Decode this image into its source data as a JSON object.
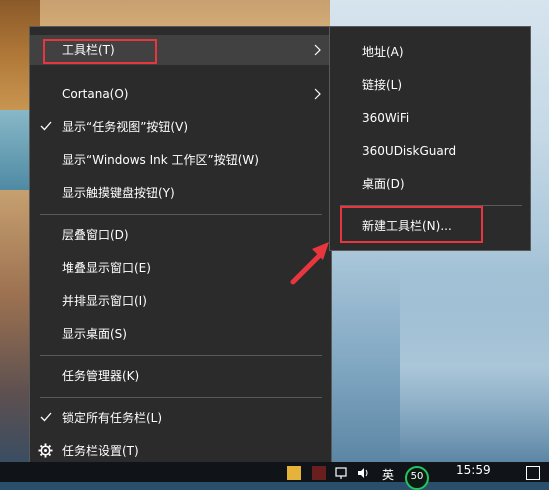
{
  "main_menu": {
    "items": [
      {
        "label": "工具栏(T)",
        "has_submenu": true
      },
      {
        "label": "Cortana(O)",
        "has_submenu": true
      },
      {
        "label": "显示“任务视图”按钮(V)",
        "checked": true
      },
      {
        "label": "显示“Windows Ink 工作区”按钮(W)"
      },
      {
        "label": "显示触摸键盘按钮(Y)"
      },
      {
        "label": "层叠窗口(D)"
      },
      {
        "label": "堆叠显示窗口(E)"
      },
      {
        "label": "并排显示窗口(I)"
      },
      {
        "label": "显示桌面(S)"
      },
      {
        "label": "任务管理器(K)"
      },
      {
        "label": "锁定所有任务栏(L)",
        "checked": true
      },
      {
        "label": "任务栏设置(T)",
        "icon": "gear-icon"
      }
    ]
  },
  "toolbar_submenu": {
    "items": [
      {
        "label": "地址(A)"
      },
      {
        "label": "链接(L)"
      },
      {
        "label": "360WiFi"
      },
      {
        "label": "360UDiskGuard"
      },
      {
        "label": "桌面(D)"
      },
      {
        "label": "新建工具栏(N)..."
      }
    ]
  },
  "taskbar": {
    "clock": "15:59",
    "ime_indicator": "英",
    "badge_value": "50"
  },
  "colors": {
    "menu_bg": "#2b2b2b",
    "hover_bg": "#414141",
    "separator": "#5a5a5a",
    "annotation_red": "#e8363f",
    "badge_green": "#22c55e"
  }
}
